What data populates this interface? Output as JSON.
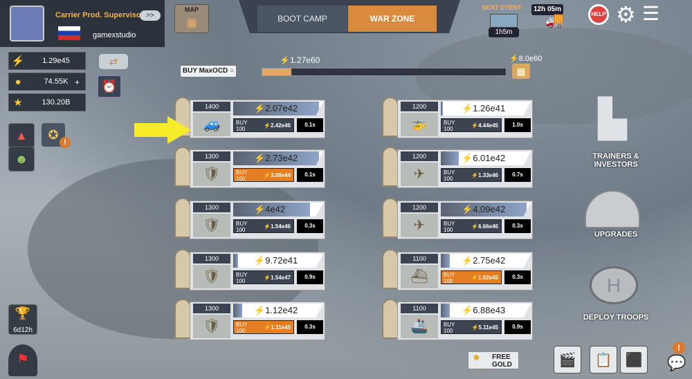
{
  "profile": {
    "rank": "Carrier Prod. Supervisor",
    "username": "gamexstudio",
    "swap_icon": ">>"
  },
  "resources": {
    "energy": "1.29e45",
    "cash": "74.55K",
    "gold": "130.20B",
    "plus": "+"
  },
  "left": {
    "trophy_timer": "6d12h"
  },
  "top": {
    "map": "MAP",
    "boot_camp": "BOOT CAMP",
    "war_zone": "WAR ZONE",
    "next_event": "NEXT EVENT:",
    "event_timer": "1h5m",
    "convoy_timer": "12h 05m",
    "help": "HELP"
  },
  "progress": {
    "buy_max": "BUY MaxOCD ○",
    "current": "⚡1.27e60",
    "goal": "⚡8.0e60",
    "percent": 0.12
  },
  "units_left": [
    {
      "count": "1400",
      "revenue": "2.07e42",
      "buy": "BUY\n100",
      "cost": "2.42e46",
      "time": "0.1s",
      "orange": false,
      "icon": "🚙",
      "fill": 0.95
    },
    {
      "count": "1300",
      "revenue": "2.73e42",
      "buy": "BUY\n100",
      "cost": "3.08e44",
      "time": "0.1s",
      "orange": true,
      "icon": "🛡",
      "fill": 0.95
    },
    {
      "count": "1300",
      "revenue": "4e42",
      "buy": "BUY\n100",
      "cost": "1.54e46",
      "time": "0.3s",
      "orange": false,
      "icon": "🛡",
      "fill": 0.85
    },
    {
      "count": "1300",
      "revenue": "9.72e41",
      "buy": "BUY\n100",
      "cost": "1.54e47",
      "time": "0.9s",
      "orange": false,
      "icon": "🛡",
      "fill": 0.05
    },
    {
      "count": "1300",
      "revenue": "1.12e42",
      "buy": "BUY\n100",
      "cost": "1.11e45",
      "time": "0.3s",
      "orange": true,
      "icon": "🛡",
      "fill": 0.1
    }
  ],
  "units_right": [
    {
      "count": "1200",
      "revenue": "1.26e41",
      "buy": "BUY\n100",
      "cost": "4.44e45",
      "time": "1.0s",
      "orange": false,
      "icon": "🚁",
      "fill": 0.02
    },
    {
      "count": "1200",
      "revenue": "6.01e42",
      "buy": "BUY\n100",
      "cost": "1.33e46",
      "time": "0.7s",
      "orange": false,
      "icon": "✈",
      "fill": 0.2
    },
    {
      "count": "1200",
      "revenue": "4.09e42",
      "buy": "BUY\n100",
      "cost": "6.66e46",
      "time": "0.3s",
      "orange": false,
      "icon": "✈",
      "fill": 0.95
    },
    {
      "count": "1100",
      "revenue": "2.75e42",
      "buy": "BUY\n100",
      "cost": "1.02e45",
      "time": "0.3s",
      "orange": true,
      "icon": "⛴",
      "fill": 0.1
    },
    {
      "count": "1100",
      "revenue": "6.88e43",
      "buy": "BUY\n100",
      "cost": "5.11e45",
      "time": "0.9s",
      "orange": false,
      "icon": "🚢",
      "fill": 0.1
    }
  ],
  "right": {
    "trainers": "TRAINERS & INVESTORS",
    "upgrades": "UPGRADES",
    "deploy": "DEPLOY TROOPS"
  },
  "bottom": {
    "free_gold": "FREE GOLD",
    "alert": "!"
  }
}
